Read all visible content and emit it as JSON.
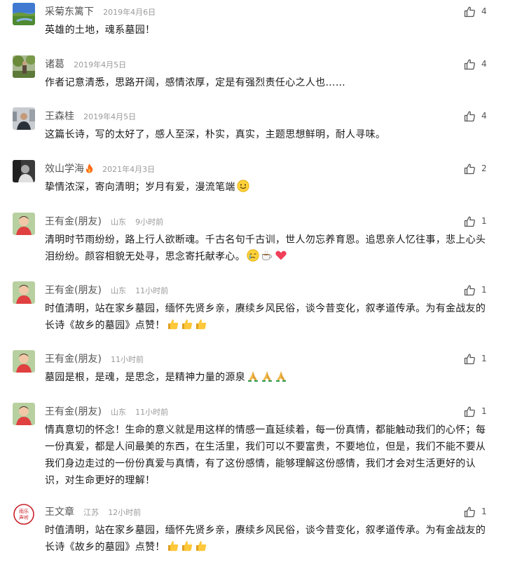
{
  "comments": [
    {
      "name": "采菊东篱下",
      "region": "",
      "time": "2019年4月6日",
      "text": "英雄的土地，魂系墓园！",
      "likes": "4",
      "avatar": "landscape"
    },
    {
      "name": "诸葛",
      "region": "",
      "time": "2019年4月5日",
      "text": "作者记意清悉，思路开阔，感情浓厚，定是有强烈责任心之人也……",
      "likes": "4",
      "avatar": "garden-man"
    },
    {
      "name": "王森桂",
      "region": "",
      "time": "2019年4月5日",
      "text": "这篇长诗，写的太好了，感人至深，朴实，真实，主题思想鲜明，耐人寻味。",
      "likes": "4",
      "avatar": "man-city"
    },
    {
      "name": "效山学海",
      "region": "",
      "time": "2021年4月3日",
      "text": "挚情浓深，寄向清明；岁月有爱，漫流笔端",
      "likes": "2",
      "avatar": "bw-portrait",
      "badge": "fire-icon",
      "emojis": [
        "smiling-face-emoji"
      ]
    },
    {
      "name": "王有金(朋友)",
      "region": "山东",
      "time": "9小时前",
      "text": "清明时节雨纷纷，路上行人欲断魂。千古名句千古训，世人勿忘养育恩。追思亲人忆往事，悲上心头泪纷纷。颜容相貌无处寻，思念寄托献孝心。",
      "likes": "1",
      "avatar": "child",
      "emojis": [
        "crying-face-emoji",
        "tea-cup-emoji",
        "red-heart-emoji"
      ]
    },
    {
      "name": "王有金(朋友)",
      "region": "山东",
      "time": "11小时前",
      "text": "时值清明，站在家乡墓园，缅怀先贤乡亲，赓续乡风民俗，谈今昔变化，叙孝道传承。为有金战友的长诗《故乡的墓园》点赞！",
      "likes": "1",
      "avatar": "child",
      "emojis": [
        "thumbs-up-emoji",
        "thumbs-up-emoji",
        "thumbs-up-emoji"
      ]
    },
    {
      "name": "王有金(朋友)",
      "region": "山东",
      "time": "11小时前",
      "text": "墓园是根，是魂，是思念，是精神力量的源泉",
      "likes": "1",
      "avatar": "child",
      "emojis": [
        "folded-hands-emoji",
        "folded-hands-emoji",
        "folded-hands-emoji"
      ]
    },
    {
      "name": "王有金(朋友)",
      "region": "山东",
      "time": "11小时前",
      "text": "情真意切的怀念！生命的意义就是用这样的情感一直延续着，每一份真情，都能触动我们的心怀；每一份真爱，都是人间最美的东西，在生活里，我们可以不要富贵，不要地位，但是，我们不能不要从我们身边走过的一份份真爱与真情，有了这份感情，能够理解这份感情，我们才会对生活更好的认识，对生命更好的理解！",
      "likes": "1",
      "avatar": "child"
    },
    {
      "name": "王文章",
      "region": "江苏",
      "time": "12小时前",
      "text": "时值清明，站在家乡墓园，缅怀先贤乡亲，赓续乡风民俗，谈今昔变化，叙孝道传承。为有金战友的长诗《故乡的墓园》点赞！",
      "likes": "1",
      "avatar": "red-seal",
      "seal_text": "雨乐声听",
      "emojis": [
        "thumbs-up-emoji",
        "thumbs-up-emoji",
        "thumbs-up-emoji"
      ]
    }
  ],
  "colors": {
    "name": "#555555",
    "meta": "#9a9a9a",
    "text": "#1a1a1a",
    "seal": "#c8202a"
  }
}
